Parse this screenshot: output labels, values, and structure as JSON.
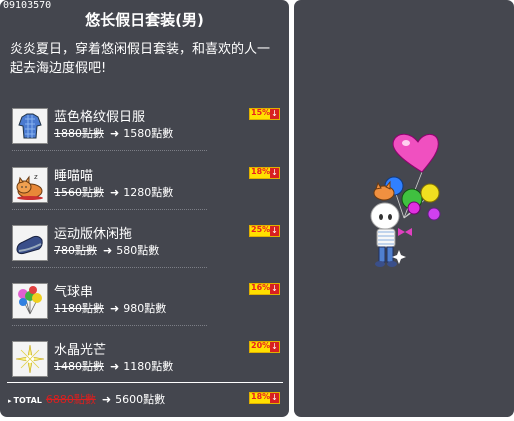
{
  "item_code": "09103570",
  "title": "悠长假日套装(男)",
  "description": "炎炎夏日，穿着悠闲假日套装，和喜欢的人一起去海边度假吧!",
  "items": [
    {
      "name": "蓝色格纹假日服",
      "old_price": "1880點數",
      "new_price": "1580點數",
      "discount": "15%",
      "icon": "blue-plaid-shirt-icon"
    },
    {
      "name": "睡喵喵",
      "old_price": "1560點數",
      "new_price": "1280點數",
      "discount": "18%",
      "icon": "sleeping-cat-icon"
    },
    {
      "name": "运动版休闲拖",
      "old_price": "780點數",
      "new_price": "580點數",
      "discount": "25%",
      "icon": "sneaker-icon"
    },
    {
      "name": "气球串",
      "old_price": "1180點數",
      "new_price": "980點數",
      "discount": "16%",
      "icon": "balloon-bunch-icon"
    },
    {
      "name": "水晶光芒",
      "old_price": "1480點數",
      "new_price": "1180點數",
      "discount": "20%",
      "icon": "crystal-sparkle-icon"
    }
  ],
  "total": {
    "label": "TOTAL",
    "old_price": "6880點數",
    "new_price": "5600點數",
    "discount": "18%"
  },
  "colors": {
    "panel": "#44464e",
    "badge": "#ffe000",
    "discount_text": "#e82020"
  }
}
